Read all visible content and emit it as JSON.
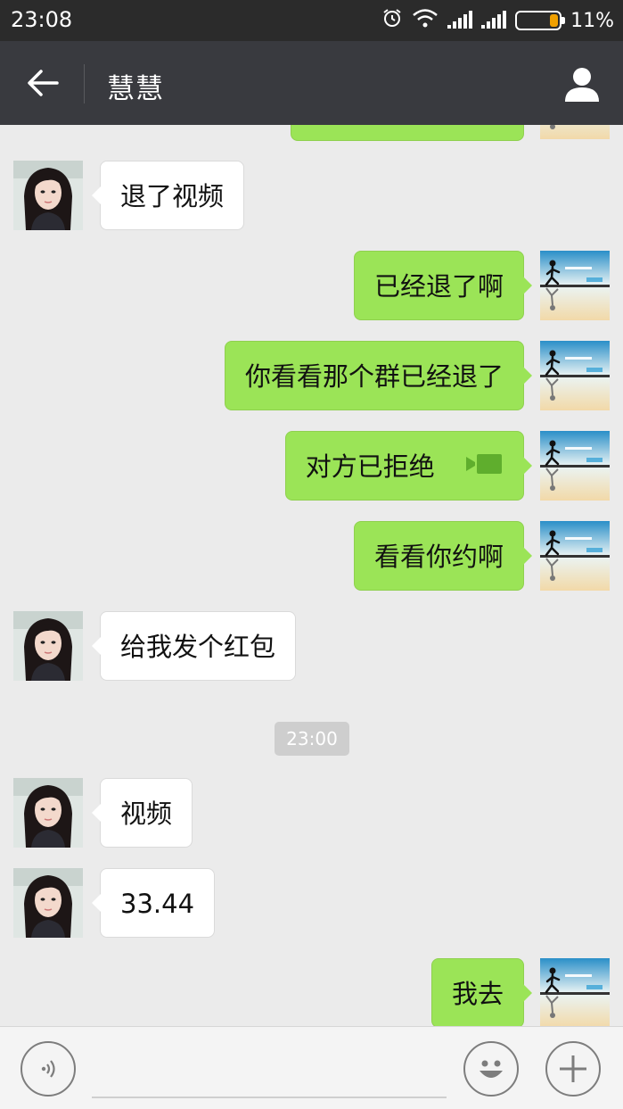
{
  "status_bar": {
    "time": "23:08",
    "battery": "11%",
    "battery_level": 0.11
  },
  "header": {
    "title": "慧慧"
  },
  "messages": [
    {
      "dir": "in",
      "text": "退了视频"
    },
    {
      "dir": "out",
      "text": "已经退了啊"
    },
    {
      "dir": "out",
      "text": "你看看那个群已经退了"
    },
    {
      "dir": "out",
      "text": "对方已拒绝",
      "icon": "video-call-icon"
    },
    {
      "dir": "out",
      "text": "看看你约啊"
    },
    {
      "dir": "in",
      "text": "给我发个红包"
    },
    {
      "dir": "in",
      "text": "视频"
    },
    {
      "dir": "in",
      "text": "33.44"
    },
    {
      "dir": "out",
      "text": "我去"
    }
  ],
  "timestamp": "23:00",
  "input_bar": {
    "value": ""
  },
  "colors": {
    "status_bg": "#2b2b2b",
    "title_bg": "#393a3f",
    "chat_bg": "#ebebeb",
    "bubble_out": "#9be457",
    "bubble_in": "#ffffff"
  },
  "icons": [
    "back-arrow-icon",
    "contact-icon",
    "alarm-icon",
    "wifi-icon",
    "signal-icon",
    "battery-icon",
    "video-call-icon",
    "voice-icon",
    "emoji-icon",
    "plus-icon"
  ]
}
